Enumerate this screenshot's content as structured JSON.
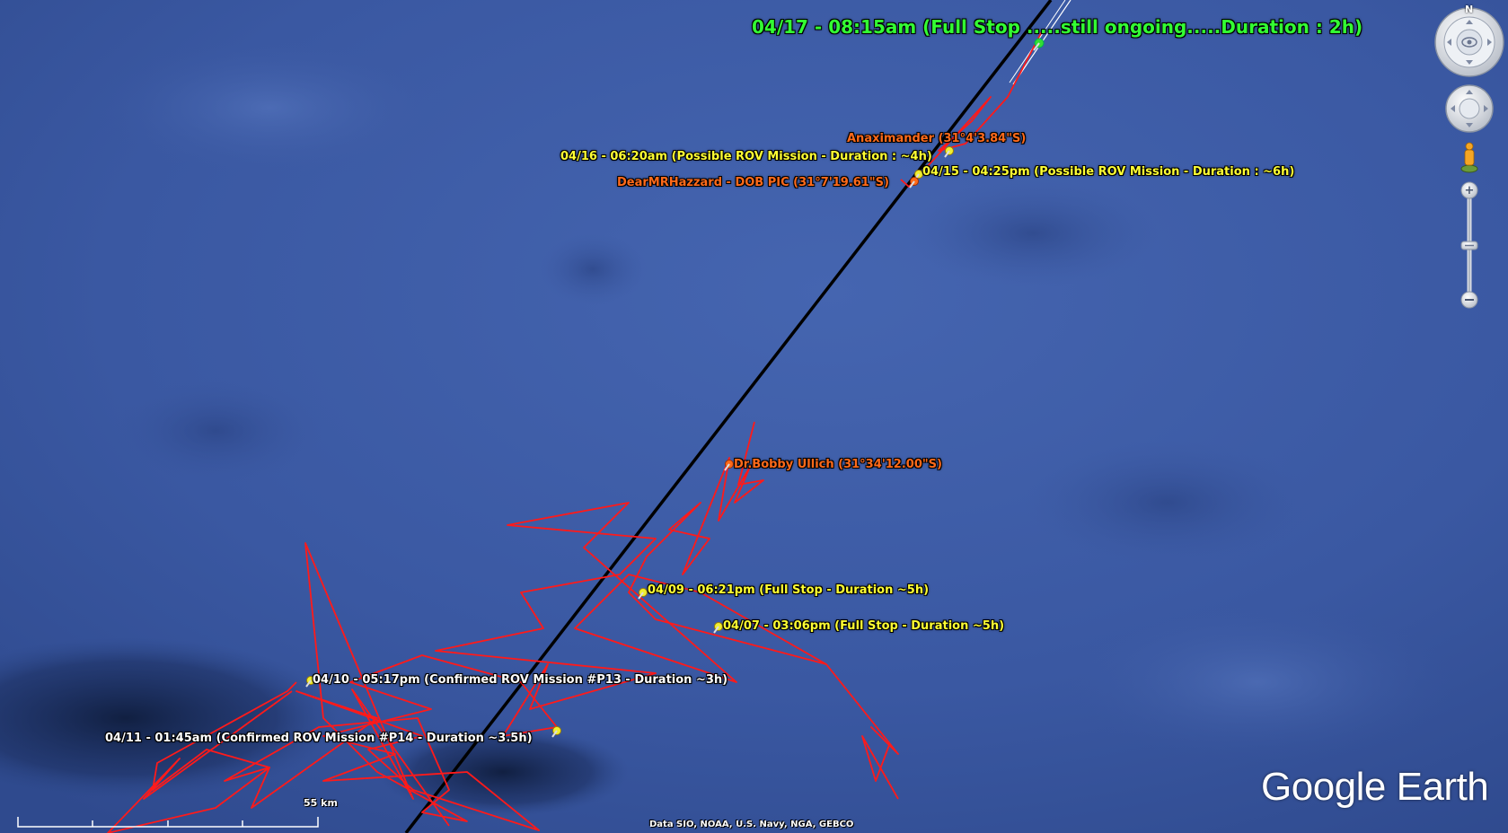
{
  "map": {
    "labels": [
      {
        "id": "full-stop-0417",
        "text": "04/17 - 08:15am (Full Stop .....still ongoing.....Duration : 2h)",
        "color": "green"
      },
      {
        "id": "anaximander",
        "text": "Anaximander (31°4'3.84\"S)",
        "color": "orange"
      },
      {
        "id": "rov-0416",
        "text": "04/16 - 06:20am (Possible ROV Mission - Duration : ~4h)",
        "color": "yellow"
      },
      {
        "id": "rov-0415",
        "text": "04/15 - 04:25pm (Possible ROV Mission - Duration : ~6h)",
        "color": "yellow"
      },
      {
        "id": "dearmrhazzard",
        "text": "DearMRHazzard - DOB PIC (31°7'19.61\"S)",
        "color": "orange"
      },
      {
        "id": "bobby-ullich",
        "text": "Dr.Bobby Ullich (31°34'12.00\"S)",
        "color": "orange"
      },
      {
        "id": "full-stop-0409",
        "text": "04/09 - 06:21pm (Full Stop - Duration ~5h)",
        "color": "yellow"
      },
      {
        "id": "full-stop-0407",
        "text": "04/07 - 03:06pm (Full Stop - Duration ~5h)",
        "color": "yellow"
      },
      {
        "id": "rov-p13",
        "text": "04/10 - 05:17pm (Confirmed ROV Mission #P13 - Duration ~3h)",
        "color": "white"
      },
      {
        "id": "rov-p14",
        "text": "04/11 - 01:45am (Confirmed ROV Mission #P14 - Duration ~3.5h)",
        "color": "white"
      }
    ],
    "scale_label": "55 km",
    "attribution": "Data SIO, NOAA, U.S. Navy, NGA, GEBCO",
    "brand": "Google Earth",
    "compass_north": "N",
    "colors": {
      "track": "#ff1a1a",
      "line": "#000000",
      "ocean": "#3a57a0"
    }
  }
}
